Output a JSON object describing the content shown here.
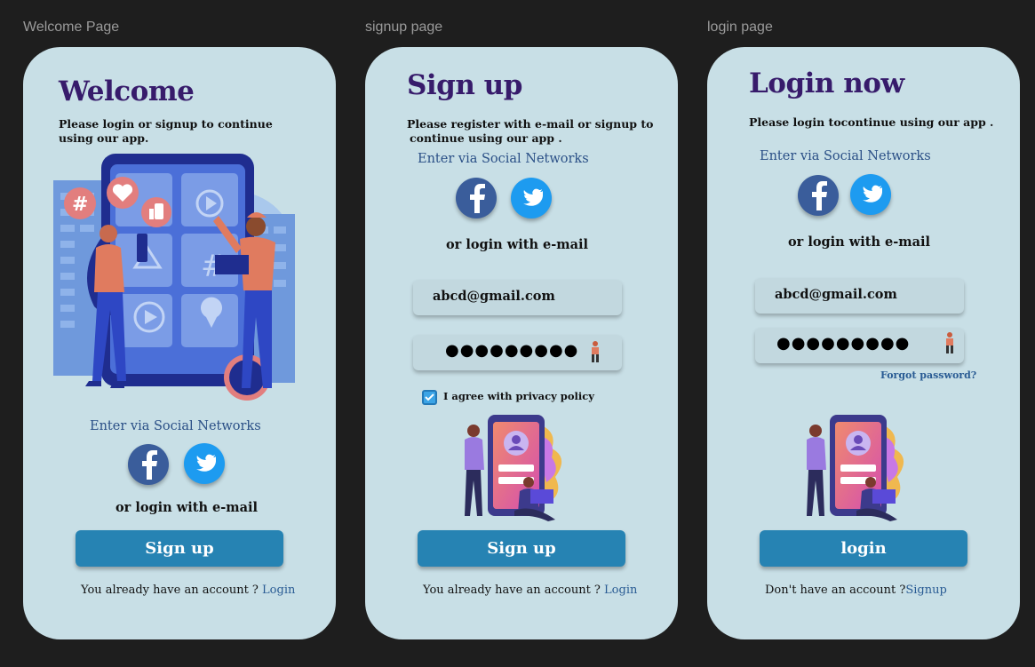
{
  "frames": {
    "welcome": "Welcome Page",
    "signup": "signup page",
    "login": "login page"
  },
  "welcome": {
    "title": "Welcome",
    "subtitle_line1": "Please login or signup to continue",
    "subtitle_line2": "using our app.",
    "social_title": "Enter via Social Networks",
    "or_email": "or login with e-mail",
    "button": "Sign up",
    "footer_text": "You already have an account ? ",
    "footer_link": "Login"
  },
  "signup": {
    "title": "Sign up",
    "subtitle_line1": "Please register with e-mail or signup to",
    "subtitle_line2": "continue using our app .",
    "social_title": "Enter via Social Networks",
    "or_email": "or login with e-mail",
    "email_value": "abcd@gmail.com",
    "password_value": "●●●●●●●●●",
    "checkbox_label": "I agree with privacy policy",
    "checkbox_checked": true,
    "button": "Sign up",
    "footer_text": "You already have an account ? ",
    "footer_link": "Login"
  },
  "login": {
    "title": "Login now",
    "subtitle": "Please login tocontinue using our app .",
    "social_title": "Enter via Social Networks",
    "or_email": "or login with e-mail",
    "email_value": "abcd@gmail.com",
    "password_value": "●●●●●●●●●",
    "forgot": "Forgot password?",
    "button": "login",
    "footer_text": "Don't have an account ?",
    "footer_link": "Signup"
  },
  "colors": {
    "card": "#c8dfe6",
    "title": "#371b6b",
    "button": "#2683b3",
    "facebook": "#3a5d9b",
    "twitter": "#1d9bf0",
    "link": "#2a5c94"
  },
  "icons": [
    "facebook-icon",
    "twitter-icon",
    "eye-icon",
    "check-icon"
  ]
}
